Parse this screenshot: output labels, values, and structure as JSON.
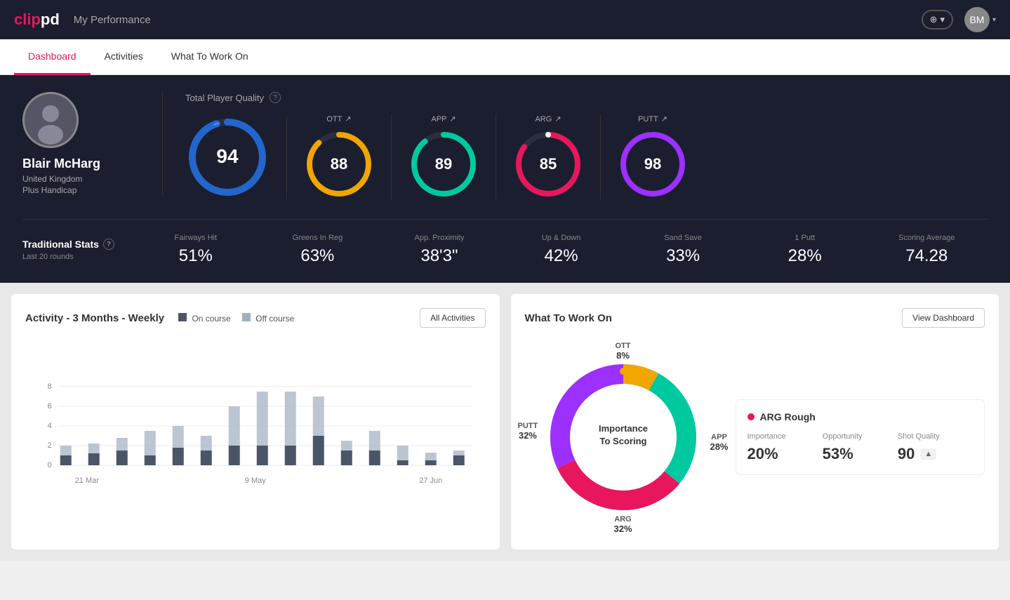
{
  "header": {
    "logo": "clippd",
    "title": "My Performance",
    "add_label": "+",
    "add_caret": "▾",
    "user_caret": "▾"
  },
  "tabs": [
    {
      "id": "dashboard",
      "label": "Dashboard",
      "active": true
    },
    {
      "id": "activities",
      "label": "Activities",
      "active": false
    },
    {
      "id": "what-to-work-on",
      "label": "What To Work On",
      "active": false
    }
  ],
  "player": {
    "name": "Blair McHarg",
    "country": "United Kingdom",
    "handicap": "Plus Handicap",
    "initials": "BM"
  },
  "total_quality": {
    "label": "Total Player Quality",
    "score": "94",
    "gauges": [
      {
        "id": "ott",
        "label": "OTT",
        "value": 88,
        "color": "#f0a500",
        "trend": "↗"
      },
      {
        "id": "app",
        "label": "APP",
        "value": 89,
        "color": "#00c9a0",
        "trend": "↗"
      },
      {
        "id": "arg",
        "label": "ARG",
        "value": 85,
        "color": "#e8175d",
        "trend": "↗"
      },
      {
        "id": "putt",
        "label": "PUTT",
        "value": 98,
        "color": "#9b30ff",
        "trend": "↗"
      }
    ]
  },
  "traditional_stats": {
    "title": "Traditional Stats",
    "period": "Last 20 rounds",
    "stats": [
      {
        "label": "Fairways Hit",
        "value": "51%"
      },
      {
        "label": "Greens In Reg",
        "value": "63%"
      },
      {
        "label": "App. Proximity",
        "value": "38'3\""
      },
      {
        "label": "Up & Down",
        "value": "42%"
      },
      {
        "label": "Sand Save",
        "value": "33%"
      },
      {
        "label": "1 Putt",
        "value": "28%"
      },
      {
        "label": "Scoring Average",
        "value": "74.28"
      }
    ]
  },
  "activity_chart": {
    "title": "Activity - 3 Months - Weekly",
    "legend": [
      {
        "label": "On course",
        "color": "#4a5568"
      },
      {
        "label": "Off course",
        "color": "#a0aec0"
      }
    ],
    "button_label": "All Activities",
    "x_labels": [
      "21 Mar",
      "9 May",
      "27 Jun"
    ],
    "y_max": 8,
    "bars": [
      {
        "week": 1,
        "on": 1,
        "off": 1.2
      },
      {
        "week": 2,
        "on": 1.2,
        "off": 1
      },
      {
        "week": 3,
        "on": 1.5,
        "off": 1.3
      },
      {
        "week": 4,
        "on": 1,
        "off": 2.5
      },
      {
        "week": 5,
        "on": 1.8,
        "off": 2.2
      },
      {
        "week": 6,
        "on": 1.5,
        "off": 1.5
      },
      {
        "week": 7,
        "on": 2,
        "off": 4
      },
      {
        "week": 8,
        "on": 2,
        "off": 5.5
      },
      {
        "week": 9,
        "on": 2,
        "off": 5.5
      },
      {
        "week": 10,
        "on": 3,
        "off": 4
      },
      {
        "week": 11,
        "on": 1.5,
        "off": 1
      },
      {
        "week": 12,
        "on": 1.5,
        "off": 2
      },
      {
        "week": 13,
        "on": 0.5,
        "off": 1.5
      },
      {
        "week": 14,
        "on": 0.5,
        "off": 0.8
      },
      {
        "week": 15,
        "on": 1,
        "off": 0.5
      }
    ]
  },
  "what_to_work_on": {
    "title": "What To Work On",
    "button_label": "View Dashboard",
    "donut_center": "Importance\nTo Scoring",
    "segments": [
      {
        "label": "OTT",
        "percent": 8,
        "color": "#f0a500",
        "position": "top"
      },
      {
        "label": "APP",
        "percent": 28,
        "color": "#00c9a0",
        "position": "right"
      },
      {
        "label": "ARG",
        "percent": 32,
        "color": "#e8175d",
        "position": "bottom"
      },
      {
        "label": "PUTT",
        "percent": 32,
        "color": "#9b30ff",
        "position": "left"
      }
    ],
    "highlight_card": {
      "title": "ARG Rough",
      "importance_label": "Importance",
      "importance_value": "20%",
      "opportunity_label": "Opportunity",
      "opportunity_value": "53%",
      "shot_quality_label": "Shot Quality",
      "shot_quality_value": "90"
    }
  }
}
